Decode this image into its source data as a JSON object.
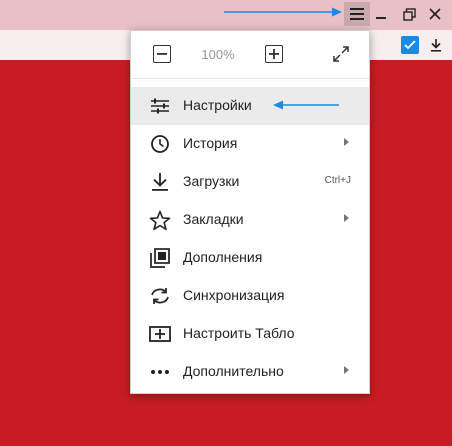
{
  "browser": {
    "menu_icon": "hamburger-icon",
    "window_controls": [
      "minimize-icon",
      "restore-icon",
      "close-icon"
    ],
    "toolbar_icons": [
      "extension-check-icon",
      "download-icon"
    ],
    "colors": {
      "page_background": "#c71c22",
      "titlebar": "#e8c0c5",
      "annotation_arrow": "#1e88e5"
    }
  },
  "menu": {
    "zoom": {
      "minus_icon": "minus-icon",
      "value": "100%",
      "plus_icon": "plus-icon",
      "fullscreen_icon": "fullscreen-icon"
    },
    "items": [
      {
        "label": "Настройки",
        "icon": "settings-sliders-icon",
        "shortcut": "",
        "submenu": false,
        "active": true
      },
      {
        "label": "История",
        "icon": "history-clock-icon",
        "shortcut": "",
        "submenu": true,
        "active": false
      },
      {
        "label": "Загрузки",
        "icon": "download-icon",
        "shortcut": "Ctrl+J",
        "submenu": false,
        "active": false
      },
      {
        "label": "Закладки",
        "icon": "star-icon",
        "shortcut": "",
        "submenu": true,
        "active": false
      },
      {
        "label": "Дополнения",
        "icon": "addons-icon",
        "shortcut": "",
        "submenu": false,
        "active": false
      },
      {
        "label": "Синхронизация",
        "icon": "sync-icon",
        "shortcut": "",
        "submenu": false,
        "active": false
      },
      {
        "label": "Настроить Табло",
        "icon": "add-tableau-icon",
        "shortcut": "",
        "submenu": false,
        "active": false
      },
      {
        "label": "Дополнительно",
        "icon": "more-dots-icon",
        "shortcut": "",
        "submenu": true,
        "active": false
      }
    ]
  }
}
